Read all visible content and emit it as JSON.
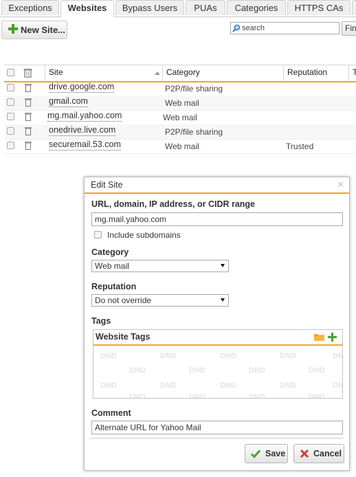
{
  "tabs": [
    "Exceptions",
    "Websites",
    "Bypass Users",
    "PUAs",
    "Categories",
    "HTTPS CAs"
  ],
  "active_tab": "Websites",
  "toolbar": {
    "new_site_label": "New Site...",
    "search_placeholder": "search",
    "find_label": "Fin"
  },
  "table": {
    "columns": [
      "Site",
      "Category",
      "Reputation",
      "T"
    ],
    "rows": [
      {
        "site": "drive.google.com",
        "category": "P2P/file sharing",
        "reputation": ""
      },
      {
        "site": "gmail.com",
        "category": "Web mail",
        "reputation": ""
      },
      {
        "site": "mg.mail.yahoo.com",
        "category": "Web mail",
        "reputation": ""
      },
      {
        "site": "onedrive.live.com",
        "category": "P2P/file sharing",
        "reputation": ""
      },
      {
        "site": "securemail.53.com",
        "category": "Web mail",
        "reputation": "Trusted"
      }
    ]
  },
  "dialog": {
    "title": "Edit Site",
    "close_icon": "×",
    "url_label": "URL, domain, IP address, or CIDR range",
    "url_value": "mg.mail.yahoo.com",
    "include_subdomains_label": "Include subdomains",
    "category_label": "Category",
    "category_value": "Web mail",
    "reputation_label": "Reputation",
    "reputation_value": "Do not override",
    "tags_label": "Tags",
    "tags_header": "Website Tags",
    "watermark": "DND",
    "comment_label": "Comment",
    "comment_value": "Alternate URL for Yahoo Mail",
    "save_label": "Save",
    "cancel_label": "Cancel"
  },
  "colors": {
    "accent_orange": "#f4a22c",
    "plus_green": "#4aa02c",
    "cancel_red": "#d43a2f"
  }
}
